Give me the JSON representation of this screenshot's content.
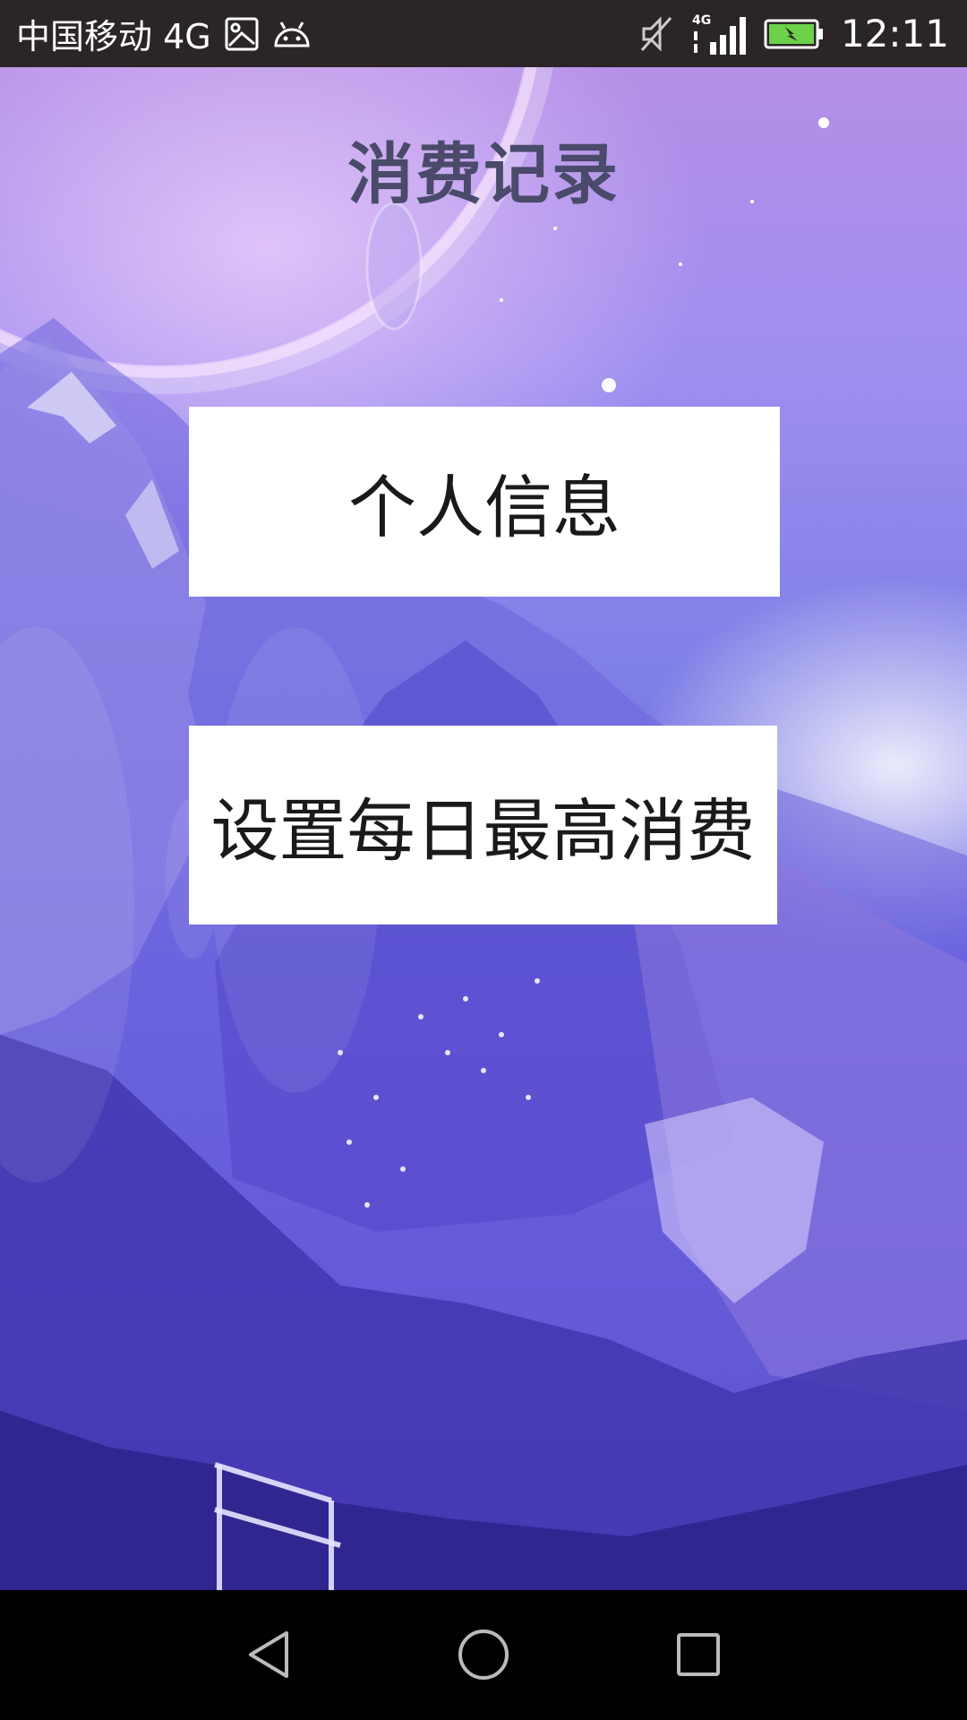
{
  "status_bar": {
    "carrier": "中国移动 4G",
    "network_label": "4G",
    "time": "12:11",
    "icons": [
      "image-notification-icon",
      "android-debug-icon",
      "mute-icon",
      "signal-icon",
      "battery-charging-icon"
    ]
  },
  "page": {
    "title": "消费记录"
  },
  "buttons": {
    "personal_info": "个人信息",
    "daily_limit": "设置每日最高消费"
  },
  "nav_bar": {
    "icons": [
      "back-icon",
      "home-icon",
      "recent-apps-icon"
    ]
  },
  "colors": {
    "status_bar_bg": "#2b2528",
    "button_bg": "#ffffff",
    "button_text": "#1a1a1a",
    "title_text": "#4a4a6a",
    "nav_bar_bg": "#000000",
    "battery_fill": "#6bd24a"
  }
}
